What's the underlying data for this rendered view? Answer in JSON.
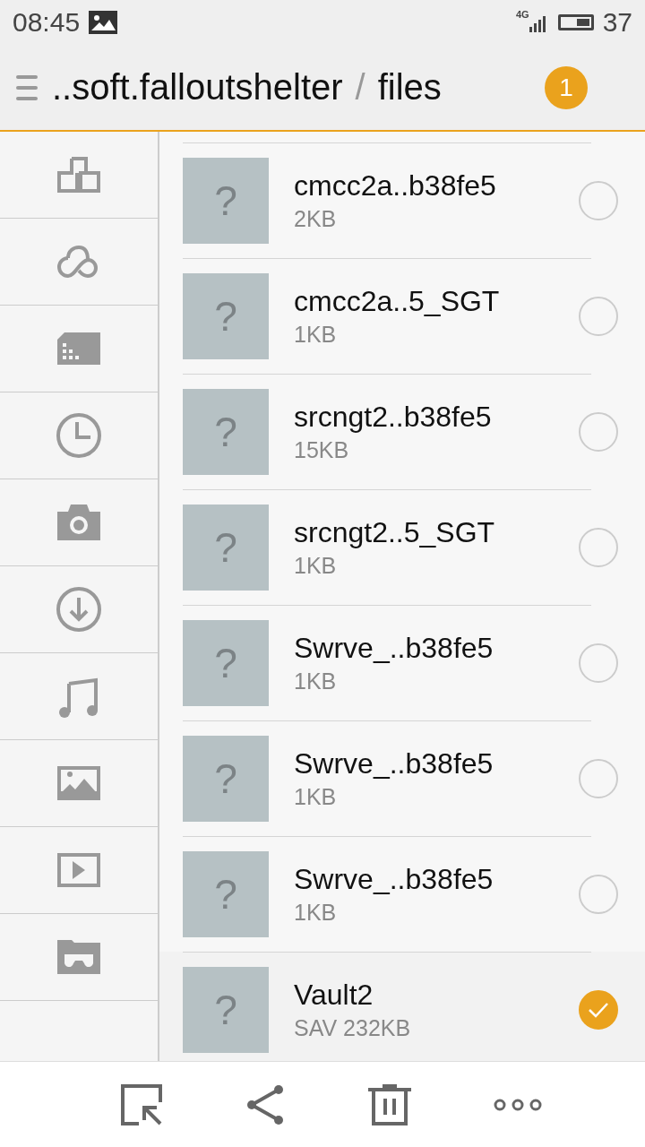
{
  "status_bar": {
    "time": "08:45",
    "network": "4G",
    "battery": "37"
  },
  "header": {
    "path_prefix": "..soft.falloutshelter",
    "separator": "/",
    "folder": "files",
    "badge": "1"
  },
  "sidebar": {
    "items": [
      {
        "kind": "apps"
      },
      {
        "kind": "cloud"
      },
      {
        "kind": "sdcard"
      },
      {
        "kind": "recent"
      },
      {
        "kind": "camera"
      },
      {
        "kind": "download"
      },
      {
        "kind": "music"
      },
      {
        "kind": "image"
      },
      {
        "kind": "video"
      },
      {
        "kind": "private"
      }
    ]
  },
  "files": [
    {
      "name": "cmcc2a..b38fe5",
      "size": "2KB",
      "selected": false
    },
    {
      "name": "cmcc2a..5_SGT",
      "size": "1KB",
      "selected": false
    },
    {
      "name": "srcngt2..b38fe5",
      "size": "15KB",
      "selected": false
    },
    {
      "name": "srcngt2..5_SGT",
      "size": "1KB",
      "selected": false
    },
    {
      "name": "Swrve_..b38fe5",
      "size": "1KB",
      "selected": false
    },
    {
      "name": "Swrve_..b38fe5",
      "size": "1KB",
      "selected": false
    },
    {
      "name": "Swrve_..b38fe5",
      "size": "1KB",
      "selected": false
    },
    {
      "name": "Vault2",
      "size": "SAV 232KB",
      "selected": true
    }
  ],
  "thumbnail_glyph": "?",
  "toolbar": [
    {
      "kind": "select"
    },
    {
      "kind": "share"
    },
    {
      "kind": "delete"
    },
    {
      "kind": "more"
    }
  ]
}
